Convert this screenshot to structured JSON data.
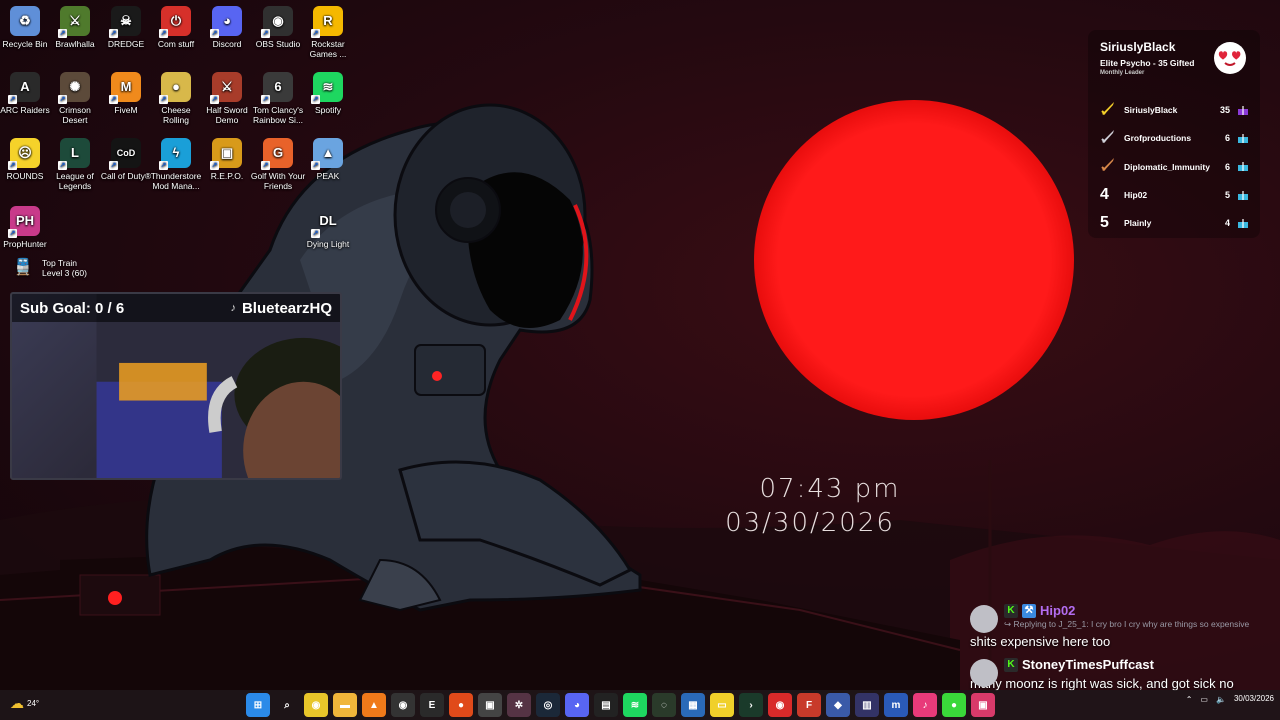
{
  "desktop": {
    "icons": [
      {
        "label": "Recycle Bin",
        "icon": "recycle-bin-icon",
        "color": "#5f8fd8",
        "glyph": "♻"
      },
      {
        "label": "Brawlhalla",
        "icon": "brawlhalla-icon",
        "color": "#4f7a2c",
        "glyph": "⚔"
      },
      {
        "label": "DREDGE",
        "icon": "dredge-icon",
        "color": "#1a1a1a",
        "glyph": "☠"
      },
      {
        "label": "Com stuff",
        "icon": "com-stuff-icon",
        "color": "#d6302a",
        "glyph": "⏻"
      },
      {
        "label": "Discord",
        "icon": "discord-icon",
        "color": "#5865f2",
        "glyph": "◕"
      },
      {
        "label": "OBS Studio",
        "icon": "obs-studio-icon",
        "color": "#303030",
        "glyph": "◉"
      },
      {
        "label": "Rockstar Games ...",
        "icon": "rockstar-icon",
        "color": "#f5b800",
        "glyph": "R"
      },
      {
        "label": "ARC Raiders",
        "icon": "arc-raiders-icon",
        "color": "#2a2a2a",
        "glyph": "A"
      },
      {
        "label": "Crimson Desert",
        "icon": "crimson-desert-icon",
        "color": "#5c4a3a",
        "glyph": "✺"
      },
      {
        "label": "FiveM",
        "icon": "fivem-icon",
        "color": "#f08a1c",
        "glyph": "M"
      },
      {
        "label": "Cheese Rolling",
        "icon": "cheese-rolling-icon",
        "color": "#d8b84a",
        "glyph": "●"
      },
      {
        "label": "Half Sword Demo",
        "icon": "half-sword-icon",
        "color": "#a83c2a",
        "glyph": "⚔"
      },
      {
        "label": "Tom Clancy's Rainbow Si...",
        "icon": "rainbow-six-icon",
        "color": "#3a3a3a",
        "glyph": "6"
      },
      {
        "label": "Spotify",
        "icon": "spotify-icon",
        "color": "#1ed760",
        "glyph": "≋"
      },
      {
        "label": "ROUNDS",
        "icon": "rounds-icon",
        "color": "#f5d22a",
        "glyph": "☹"
      },
      {
        "label": "League of Legends",
        "icon": "league-icon",
        "color": "#1d4a3a",
        "glyph": "L"
      },
      {
        "label": "Call of Duty®",
        "icon": "call-of-duty-icon",
        "color": "#141414",
        "glyph": "CoD"
      },
      {
        "label": "Thunderstore Mod Mana...",
        "icon": "thunderstore-icon",
        "color": "#1a9fd8",
        "glyph": "ϟ"
      },
      {
        "label": "R.E.P.O.",
        "icon": "repo-icon",
        "color": "#d89a1a",
        "glyph": "▣"
      },
      {
        "label": "Golf With Your Friends",
        "icon": "golf-icon",
        "color": "#e8622a",
        "glyph": "G"
      },
      {
        "label": "PEAK",
        "icon": "peak-icon",
        "color": "#6aa4e0",
        "glyph": "▲"
      },
      {
        "label": "PropHunter",
        "icon": "prophunter-icon",
        "color": "#c83a8a",
        "glyph": "PH"
      },
      {
        "label": "Dying Light",
        "icon": "dying-light-icon",
        "color": "transparent",
        "glyph": "DL"
      }
    ]
  },
  "top_train": {
    "title": "Top Train",
    "level": "Level 3",
    "count": "(60)"
  },
  "webcam": {
    "title": "Sub Goal:",
    "goal": "0 / 6",
    "channel": "BluetearzHQ"
  },
  "clock": {
    "time": "07:43 pm",
    "date": "03/30/2026"
  },
  "leaderboard": {
    "leader_name": "SiriuslyBlack",
    "leader_sub": "Elite Psycho - 35 Gifted",
    "leader_caption": "Monthly Leader",
    "rows": [
      {
        "rank": "",
        "rank_icon": "gold-sword-icon",
        "name": "SiriuslyBlack",
        "count": "35",
        "gift_color": "#8b3ad8"
      },
      {
        "rank": "",
        "rank_icon": "silver-sword-icon",
        "name": "Grofproductions",
        "count": "6",
        "gift_color": "#3ab8e0"
      },
      {
        "rank": "",
        "rank_icon": "bronze-sword-icon",
        "name": "Diplomatic_Immunity",
        "count": "6",
        "gift_color": "#3ab8e0"
      },
      {
        "rank": "4",
        "rank_icon": "",
        "name": "Hip02",
        "count": "5",
        "gift_color": "#3ab8e0"
      },
      {
        "rank": "5",
        "rank_icon": "",
        "name": "Plainly",
        "count": "4",
        "gift_color": "#3ab8e0"
      }
    ]
  },
  "chat": {
    "messages": [
      {
        "user": "Hip02",
        "user_color": "#b36df0",
        "reply": "Replying to J_25_1: I cry bro I cry why are things so expensive",
        "text": "shits expensive here too"
      },
      {
        "user": "StoneyTimesPuffcast",
        "user_color": "#ffffff",
        "reply": "",
        "text": "many moonz is right was sick, and got sick no"
      }
    ]
  },
  "taskbar": {
    "weather": "24°",
    "date": "30/03/2026",
    "apps": [
      {
        "icon": "windows-start-icon",
        "color": "#2b8ae8",
        "glyph": "⊞"
      },
      {
        "icon": "search-icon",
        "color": "transparent",
        "glyph": "⌕"
      },
      {
        "icon": "chrome-icon",
        "color": "#e8c62a",
        "glyph": "◉"
      },
      {
        "icon": "file-explorer-icon",
        "color": "#f0b63a",
        "glyph": "▬"
      },
      {
        "icon": "vlc-icon",
        "color": "#f07a1a",
        "glyph": "▲"
      },
      {
        "icon": "obs-icon",
        "color": "#333333",
        "glyph": "◉"
      },
      {
        "icon": "epic-games-icon",
        "color": "#2a2a2a",
        "glyph": "E"
      },
      {
        "icon": "brave-icon",
        "color": "#e04a1a",
        "glyph": "●"
      },
      {
        "icon": "app-icon",
        "color": "#444444",
        "glyph": "▣"
      },
      {
        "icon": "gear-app-icon",
        "color": "#553344",
        "glyph": "✲"
      },
      {
        "icon": "steam-icon",
        "color": "#1b2838",
        "glyph": "◎"
      },
      {
        "icon": "discord-icon",
        "color": "#5865f2",
        "glyph": "◕"
      },
      {
        "icon": "app2-icon",
        "color": "#222222",
        "glyph": "▤"
      },
      {
        "icon": "spotify-icon",
        "color": "#1ed760",
        "glyph": "≋"
      },
      {
        "icon": "app3-icon",
        "color": "#2a3a2a",
        "glyph": "◌"
      },
      {
        "icon": "app4-icon",
        "color": "#2a6ab8",
        "glyph": "▦"
      },
      {
        "icon": "sticky-notes-icon",
        "color": "#f0d02a",
        "glyph": "▭"
      },
      {
        "icon": "terminal-icon",
        "color": "#1a3a2a",
        "glyph": "›"
      },
      {
        "icon": "app5-icon",
        "color": "#d82a2a",
        "glyph": "◉"
      },
      {
        "icon": "app6-icon",
        "color": "#c83a2a",
        "glyph": "F"
      },
      {
        "icon": "app7-icon",
        "color": "#3a5aa8",
        "glyph": "◆"
      },
      {
        "icon": "app8-icon",
        "color": "#333366",
        "glyph": "▥"
      },
      {
        "icon": "mobi-icon",
        "color": "#2a5ab8",
        "glyph": "m"
      },
      {
        "icon": "tiktok-icon",
        "color": "#e83a7a",
        "glyph": "♪"
      },
      {
        "icon": "app9-icon",
        "color": "#3ad83a",
        "glyph": "●"
      },
      {
        "icon": "app10-icon",
        "color": "#d83a6a",
        "glyph": "▣"
      }
    ]
  }
}
